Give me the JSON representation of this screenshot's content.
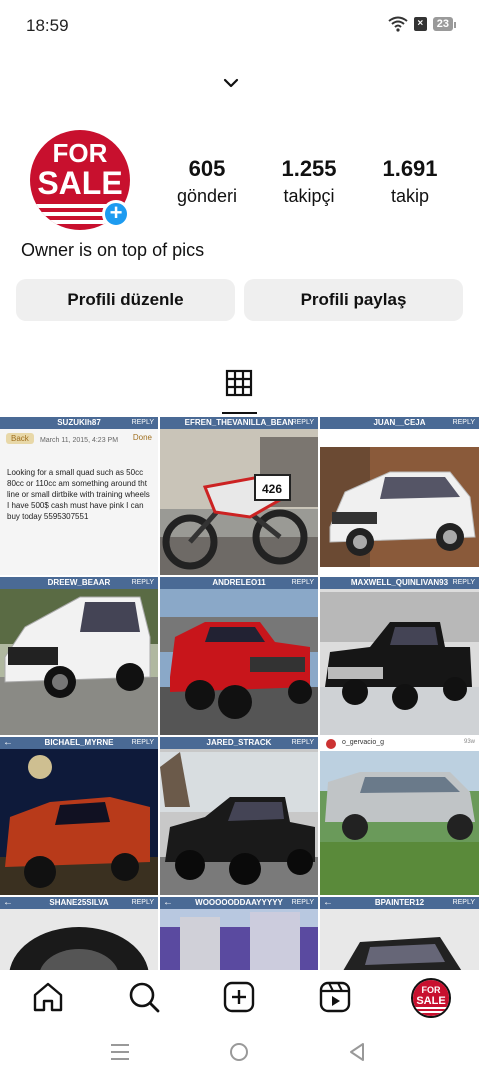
{
  "status_bar": {
    "time": "18:59",
    "battery": "23"
  },
  "profile": {
    "logo_text_line1": "FOR",
    "logo_text_line2": "SALE",
    "stats": [
      {
        "value": "605",
        "label": "gönderi"
      },
      {
        "value": "1.255",
        "label": "takipçi"
      },
      {
        "value": "1.691",
        "label": "takip"
      }
    ],
    "bio": "Owner is on top of pics",
    "edit_button": "Profili düzenle",
    "share_button": "Profili paylaş"
  },
  "grid": {
    "posts": [
      {
        "username": "SUZUKIh87",
        "reply": "REPLY",
        "type": "note",
        "back": "Back",
        "done": "Done",
        "date": "March 11, 2015, 4:23 PM",
        "text": "Looking for a small quad such as 50cc 80cc or 110cc am something around tht line or small dirtbike with training wheels I have 500$ cash must have pink I can buy today 5595307551"
      },
      {
        "username": "EFREN_THEVANILLA_BEAN",
        "reply": "REPLY",
        "type": "dirtbike"
      },
      {
        "username": "JUAN__CEJA",
        "reply": "REPLY",
        "type": "white-sedan"
      },
      {
        "username": "DREEW_BEAAR",
        "reply": "REPLY",
        "type": "white-suv"
      },
      {
        "username": "ANDRELEO11",
        "reply": "REPLY",
        "type": "red-truck"
      },
      {
        "username": "MAXWELL_QUINLIVAN93",
        "reply": "REPLY",
        "type": "black-truck"
      },
      {
        "username": "BICHAEL_MYRNE",
        "reply": "REPLY",
        "type": "red-bronco"
      },
      {
        "username": "JARED_STRACK",
        "reply": "REPLY",
        "type": "black-f150"
      },
      {
        "username": "o_gervacio_g",
        "time": "93w",
        "type": "silver-suburban"
      },
      {
        "username": "SHANE25SILVA",
        "reply": "REPLY",
        "type": "tire"
      },
      {
        "username": "WOOOOODDAAYYYYY",
        "reply": "REPLY",
        "type": "building"
      },
      {
        "username": "BPAINTER12",
        "reply": "REPLY",
        "type": "car-top"
      }
    ]
  },
  "colors": {
    "accent": "#1d9bf0",
    "button_bg": "#efefef",
    "sale_red": "#c8102e",
    "tile_bar": "#4a6a95"
  },
  "icons": [
    "wifi-icon",
    "home-icon",
    "search-icon",
    "create-icon",
    "reels-icon",
    "grid-icon",
    "chevron-down-icon",
    "menu-icon",
    "circle-home-icon",
    "back-triangle-icon"
  ]
}
